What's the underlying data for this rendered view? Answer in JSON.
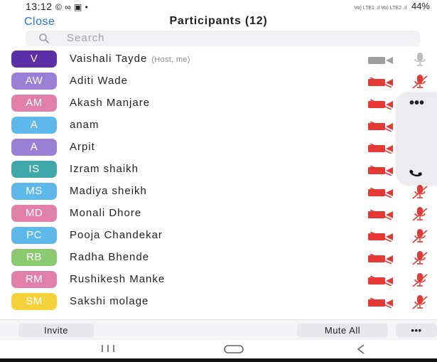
{
  "status_bar": {
    "time": "13:12",
    "left_icons": "© ∞ ▣ •",
    "network": "Vo) LTE1 .ıl  Vo) LTE2 .ıl",
    "battery": "44%"
  },
  "header": {
    "close_label": "Close",
    "title": "Participants (12)"
  },
  "search": {
    "placeholder": "Search"
  },
  "participants": [
    {
      "initials": "V",
      "name": "Vaishali Tayde",
      "tag": "(Host, me)",
      "color": "#5b2fa6",
      "video": "on",
      "mic": "on"
    },
    {
      "initials": "AW",
      "name": "Aditi Wade",
      "color": "#9b7ed6",
      "video": "off",
      "mic": "muted"
    },
    {
      "initials": "AM",
      "name": "Akash Manjare",
      "color": "#e080a8",
      "video": "off",
      "mic": "muted"
    },
    {
      "initials": "A",
      "name": "anam",
      "color": "#5db8ec",
      "video": "off",
      "mic": "muted"
    },
    {
      "initials": "A",
      "name": "Arpit",
      "color": "#9b7ed6",
      "video": "off",
      "mic": "muted"
    },
    {
      "initials": "IS",
      "name": "Izram shaikh",
      "color": "#3fa8a8",
      "video": "off",
      "mic": "muted"
    },
    {
      "initials": "MS",
      "name": "Madiya sheikh",
      "color": "#5db8ec",
      "video": "off",
      "mic": "muted"
    },
    {
      "initials": "MD",
      "name": "Monali Dhore",
      "color": "#e080a8",
      "video": "off",
      "mic": "muted"
    },
    {
      "initials": "PC",
      "name": "Pooja Chandekar",
      "color": "#5db8ec",
      "video": "off",
      "mic": "muted"
    },
    {
      "initials": "RB",
      "name": "Radha Bhende",
      "color": "#8cca72",
      "video": "off",
      "mic": "muted"
    },
    {
      "initials": "RM",
      "name": "Rushikesh Manke",
      "color": "#e080a8",
      "video": "off",
      "mic": "muted"
    },
    {
      "initials": "SM",
      "name": "Sakshi molage",
      "color": "#f3d23a",
      "video": "off",
      "mic": "muted"
    }
  ],
  "side_panel": {
    "more_label": "•••",
    "call_icon": "phone-icon"
  },
  "bottom_bar": {
    "invite_label": "Invite",
    "mute_all_label": "Mute All",
    "more_label": "•••"
  },
  "nav_bar": {
    "recents_icon": "recents-icon",
    "home_icon": "home-icon",
    "back_icon": "back-icon"
  },
  "colors": {
    "accent": "#1a73e8",
    "muted_red": "#e53935",
    "active_gray": "#9e9e9e"
  }
}
